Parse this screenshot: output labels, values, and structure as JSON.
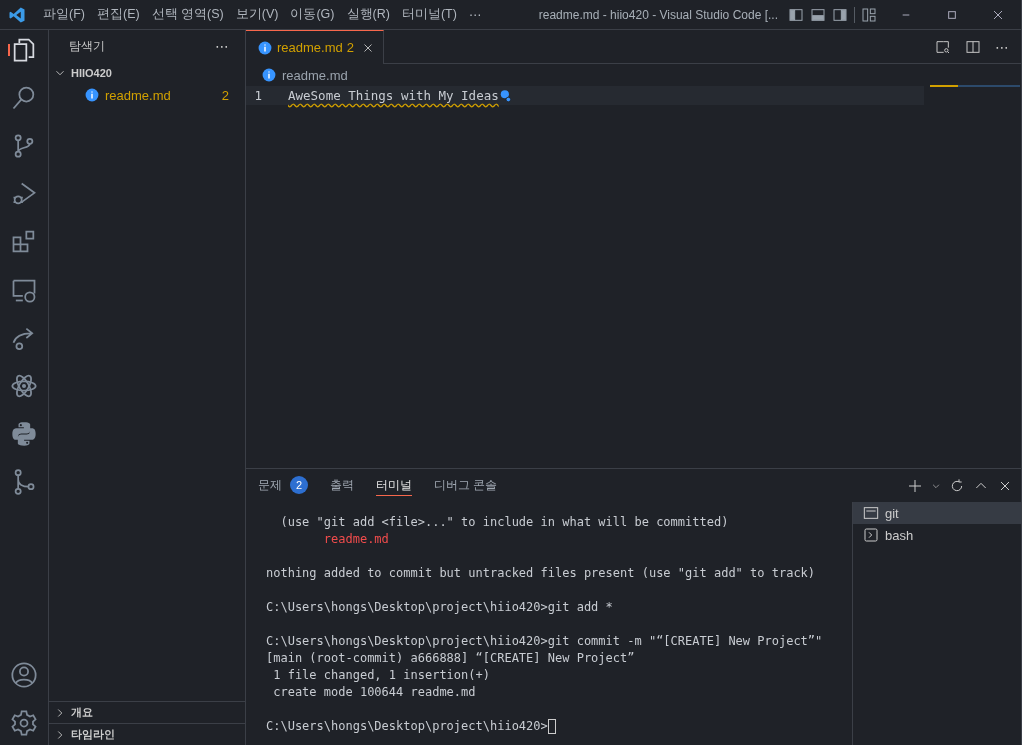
{
  "title_bar": {
    "menus": [
      "파일(F)",
      "편집(E)",
      "선택 영역(S)",
      "보기(V)",
      "이동(G)",
      "실행(R)",
      "터미널(T)"
    ],
    "more": "⋯",
    "title": "readme.md - hiio420 - Visual Studio Code [..."
  },
  "activity_bar": {
    "items": [
      {
        "kind": "files",
        "selected": true
      },
      {
        "kind": "search",
        "selected": false
      },
      {
        "kind": "branch",
        "selected": false
      },
      {
        "kind": "debug",
        "selected": false
      },
      {
        "kind": "extensions",
        "selected": false
      },
      {
        "kind": "remote",
        "selected": false
      },
      {
        "kind": "share",
        "selected": false
      },
      {
        "kind": "atom",
        "selected": false
      },
      {
        "kind": "python",
        "selected": false
      },
      {
        "kind": "graph",
        "selected": false
      }
    ],
    "bottom": [
      {
        "kind": "account"
      },
      {
        "kind": "gear"
      }
    ]
  },
  "sidebar": {
    "title": "탐색기",
    "more": "⋯",
    "folder": {
      "name": "HIIO420",
      "expanded": true,
      "children": [
        {
          "name": "readme.md",
          "badge": "2"
        }
      ]
    },
    "sections": [
      {
        "label": "개요",
        "expanded": false
      },
      {
        "label": "타임라인",
        "expanded": false
      }
    ]
  },
  "editor": {
    "tabs": [
      {
        "label": "readme.md",
        "badge": "2",
        "selected": true
      }
    ],
    "breadcrumb": "readme.md",
    "lines": [
      {
        "number": "1",
        "text": "AweSome Things with My Ideas",
        "squiggle": true
      }
    ]
  },
  "panel": {
    "tabs": [
      {
        "label": "문제",
        "badge": "2",
        "selected": false
      },
      {
        "label": "출력",
        "selected": false
      },
      {
        "label": "터미널",
        "selected": true
      },
      {
        "label": "디버그 콘솔",
        "selected": false
      }
    ],
    "terminal": [
      [
        {
          "text": "  (use \"git add <file>...\" to include in what will be committed)",
          "kind": "normal"
        },
        {
          "text": "        readme.md",
          "kind": "untracked"
        }
      ],
      [
        {
          "text": "nothing added to commit but untracked files present (use \"git add\" to track)",
          "kind": "normal"
        }
      ],
      [
        {
          "text": "C:\\Users\\hongs\\Desktop\\project\\hiio420>git add *",
          "kind": "normal"
        }
      ],
      [
        {
          "text": "C:\\Users\\hongs\\Desktop\\project\\hiio420>git commit -m \"“[CREATE] New Project”\"",
          "kind": "normal"
        },
        {
          "text": "[main (root-commit) a666888] “[CREATE] New Project”",
          "kind": "normal"
        },
        {
          "text": " 1 file changed, 1 insertion(+)",
          "kind": "normal"
        },
        {
          "text": " create mode 100644 readme.md",
          "kind": "normal"
        }
      ],
      [
        {
          "text": "C:\\Users\\hongs\\Desktop\\project\\hiio420>",
          "kind": "normal",
          "cursor": true
        }
      ]
    ],
    "terminals": [
      {
        "name": "git",
        "kind": "cmd",
        "selected": true
      },
      {
        "name": "bash",
        "kind": "shell",
        "selected": false
      }
    ]
  }
}
